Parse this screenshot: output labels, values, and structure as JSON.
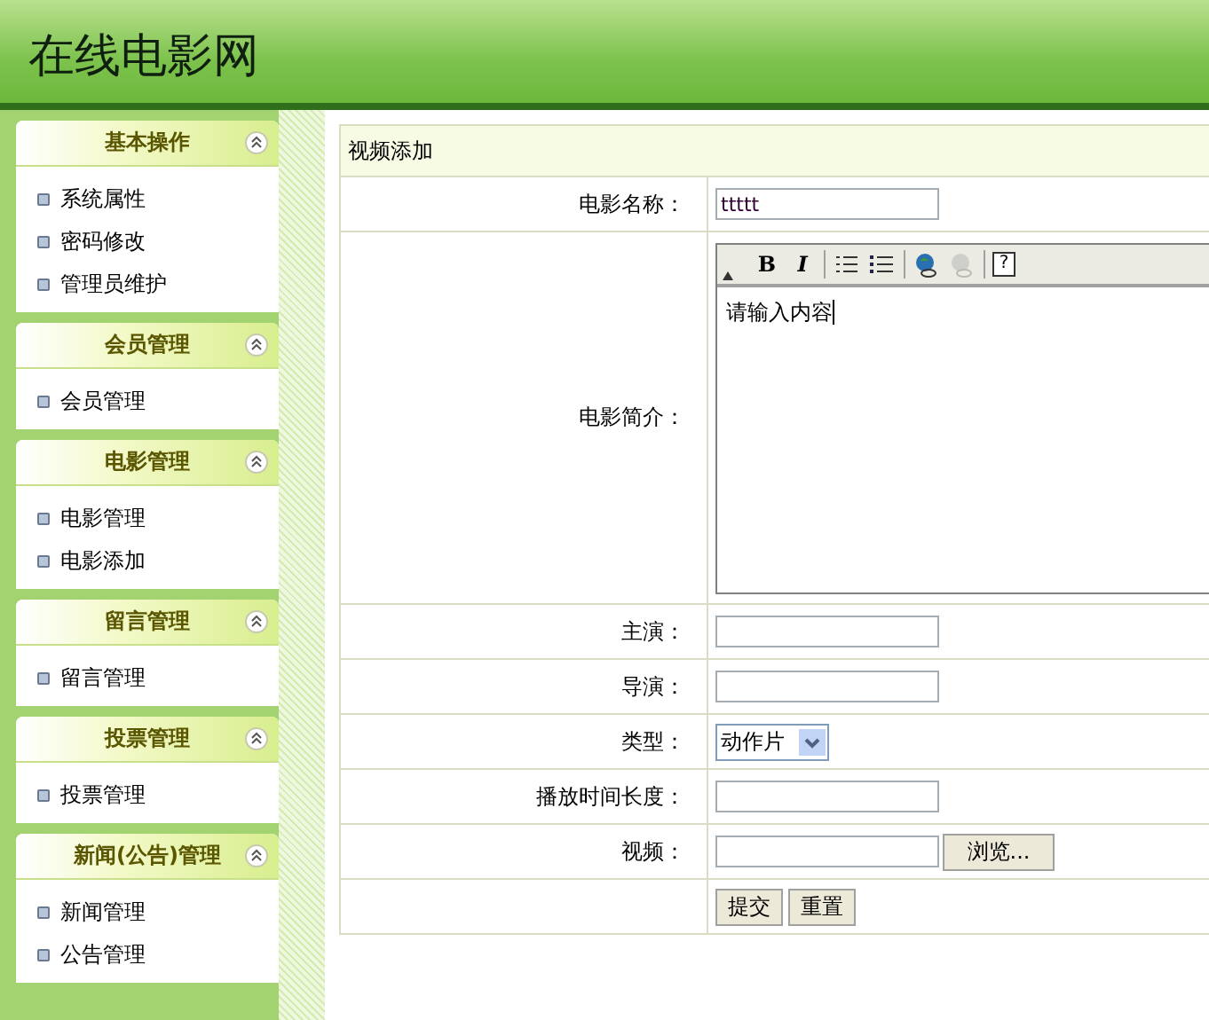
{
  "header": {
    "title": "在线电影网"
  },
  "sidebar": {
    "panels": [
      {
        "title": "基本操作",
        "expanded": true,
        "items": [
          "系统属性",
          "密码修改",
          "管理员维护"
        ]
      },
      {
        "title": "会员管理",
        "expanded": true,
        "items": [
          "会员管理"
        ]
      },
      {
        "title": "电影管理",
        "expanded": true,
        "items": [
          "电影管理",
          "电影添加"
        ]
      },
      {
        "title": "留言管理",
        "expanded": true,
        "items": [
          "留言管理"
        ]
      },
      {
        "title": "投票管理",
        "expanded": true,
        "items": [
          "投票管理"
        ]
      },
      {
        "title": "新闻(公告)管理",
        "expanded": true,
        "items": [
          "新闻管理",
          "公告管理"
        ]
      }
    ]
  },
  "form": {
    "title": "视频添加",
    "rows": [
      {
        "kind": "text",
        "label": "电影名称：",
        "value": "ttttt"
      },
      {
        "kind": "editor",
        "label": "电影简介：",
        "value": "请输入内容",
        "toolbar": [
          [
            {
              "kind": "bold",
              "label": "B"
            },
            {
              "kind": "italic",
              "label": "I"
            }
          ],
          [
            {
              "kind": "ordered-list"
            },
            {
              "kind": "bullet-list"
            }
          ],
          [
            {
              "kind": "link",
              "disabled": false
            },
            {
              "kind": "unlink",
              "disabled": true
            }
          ],
          [
            {
              "kind": "help",
              "label": "?"
            }
          ]
        ]
      },
      {
        "kind": "text",
        "label": "主演："
      },
      {
        "kind": "text",
        "label": "导演："
      },
      {
        "kind": "select",
        "label": "类型：",
        "value": "动作片"
      },
      {
        "kind": "text",
        "label": "播放时间长度："
      },
      {
        "kind": "file",
        "label": "视频：",
        "button": "浏览..."
      },
      {
        "kind": "buttons",
        "buttons": [
          "提交",
          "重置"
        ]
      }
    ]
  }
}
